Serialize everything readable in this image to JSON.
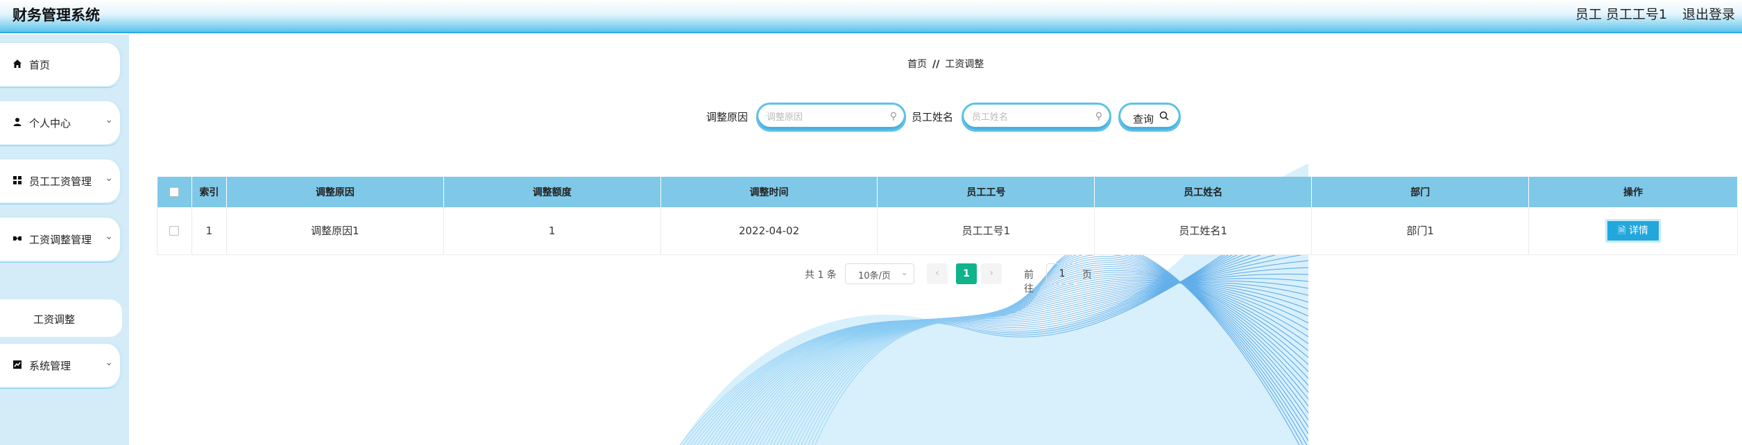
{
  "header": {
    "title": "财务管理系统",
    "user": "员工 员工工号1",
    "logout": "退出登录"
  },
  "sidebar": {
    "items": [
      {
        "label": "首页",
        "icon": "home-icon"
      },
      {
        "label": "个人中心",
        "icon": "user-icon"
      },
      {
        "label": "员工工资管理",
        "icon": "grid-icon"
      },
      {
        "label": "工资调整管理",
        "icon": "adjust-icon"
      },
      {
        "label": "系统管理",
        "icon": "chart-icon"
      }
    ],
    "submenu": {
      "label": "工资调整"
    }
  },
  "breadcrumb": {
    "home": "首页",
    "separator": "//",
    "current": "工资调整"
  },
  "search": {
    "reason_label": "调整原因",
    "reason_placeholder": "调整原因",
    "name_label": "员工姓名",
    "name_placeholder": "员工姓名",
    "query_label": "查询"
  },
  "table": {
    "headers": [
      "索引",
      "调整原因",
      "调整额度",
      "调整时间",
      "员工工号",
      "员工姓名",
      "部门",
      "操作"
    ],
    "rows": [
      {
        "index": "1",
        "reason": "调整原因1",
        "amount": "1",
        "time": "2022-04-02",
        "emp_no": "员工工号1",
        "emp_name": "员工姓名1",
        "dept": "部门1",
        "action": "详情"
      }
    ]
  },
  "pagination": {
    "total": "共 1 条",
    "page_size": "10条/页",
    "current_page": "1",
    "goto_label": "前往",
    "goto_value": "1",
    "unit": "页"
  }
}
